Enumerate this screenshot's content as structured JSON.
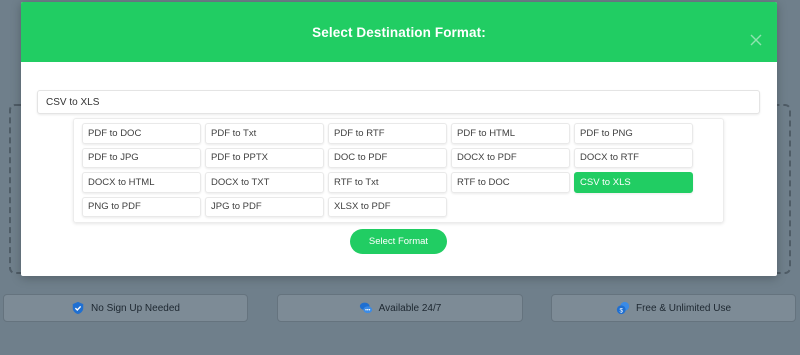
{
  "modal": {
    "title": "Select Destination Format:",
    "search_value": "CSV to XLS",
    "select_button_label": "Select Format",
    "formats": [
      {
        "label": "PDF to DOC",
        "selected": false
      },
      {
        "label": "PDF to Txt",
        "selected": false
      },
      {
        "label": "PDF to RTF",
        "selected": false
      },
      {
        "label": "PDF to HTML",
        "selected": false
      },
      {
        "label": "PDF to PNG",
        "selected": false
      },
      {
        "label": "PDF to JPG",
        "selected": false
      },
      {
        "label": "PDF to PPTX",
        "selected": false
      },
      {
        "label": "DOC to PDF",
        "selected": false
      },
      {
        "label": "DOCX to PDF",
        "selected": false
      },
      {
        "label": "DOCX to RTF",
        "selected": false
      },
      {
        "label": "DOCX to HTML",
        "selected": false
      },
      {
        "label": "DOCX to TXT",
        "selected": false
      },
      {
        "label": "RTF to Txt",
        "selected": false
      },
      {
        "label": "RTF to DOC",
        "selected": false
      },
      {
        "label": "CSV to XLS",
        "selected": true
      },
      {
        "label": "PNG to PDF",
        "selected": false
      },
      {
        "label": "JPG to PDF",
        "selected": false
      },
      {
        "label": "XLSX to PDF",
        "selected": false
      }
    ]
  },
  "features": {
    "item1": {
      "label": "No Sign Up Needed",
      "icon": "shield-check-icon"
    },
    "item2": {
      "label": "Available 24/7",
      "icon": "chat-bubbles-icon"
    },
    "item3": {
      "label": "Free & Unlimited Use",
      "icon": "coins-icon"
    }
  },
  "colors": {
    "accent": "#21cd63",
    "overlay": "#6f7f8b",
    "icon_blue": "#1f6fd1"
  }
}
